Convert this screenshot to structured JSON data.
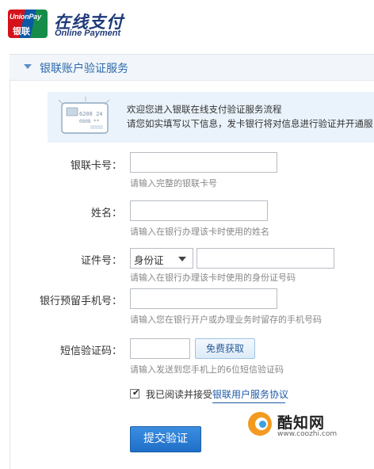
{
  "header": {
    "logo_text_en": "UnionPay",
    "logo_text_cn": "银联",
    "title_cn": "在线支付",
    "title_en": "Online Payment"
  },
  "section": {
    "title": "银联账户验证服务"
  },
  "welcome": {
    "line1": "欢迎您进入银联在线支付验证服务流程",
    "line2": "请您如实填写以下信息，发卡银行将对信息进行验证并开通服",
    "card_number_display": "6208 24",
    "card_sub_display": "0808 **"
  },
  "form": {
    "card_label": "银联卡号：",
    "card_value": "",
    "card_hint": "请输入完整的银联卡号",
    "name_label": "姓名：",
    "name_value": "",
    "name_hint": "请输入在银行办理该卡时使用的姓名",
    "id_label": "证件号：",
    "id_type_selected": "身份证",
    "id_value": "",
    "id_hint": "请输入在银行办理该卡时使用的身份证号码",
    "phone_label": "银行预留手机号：",
    "phone_value": "",
    "phone_hint": "请输入您在银行开户或办理业务时留存的手机号码",
    "sms_label": "短信验证码：",
    "sms_value": "",
    "sms_button": "免费获取",
    "sms_hint": "请输入发送到您手机上的6位短信验证码",
    "agree_checked": true,
    "agree_text": "我已阅读并接受",
    "agree_link": "银联用户服务协议",
    "submit_label": "提交验证"
  },
  "watermark": {
    "name": "酷知网",
    "url": "www.coozhi.com"
  },
  "colors": {
    "brand_blue": "#1e3a78",
    "section_blue": "#2c6aad",
    "submit_blue": "#1f6fc8",
    "hint_gray": "#888888"
  }
}
